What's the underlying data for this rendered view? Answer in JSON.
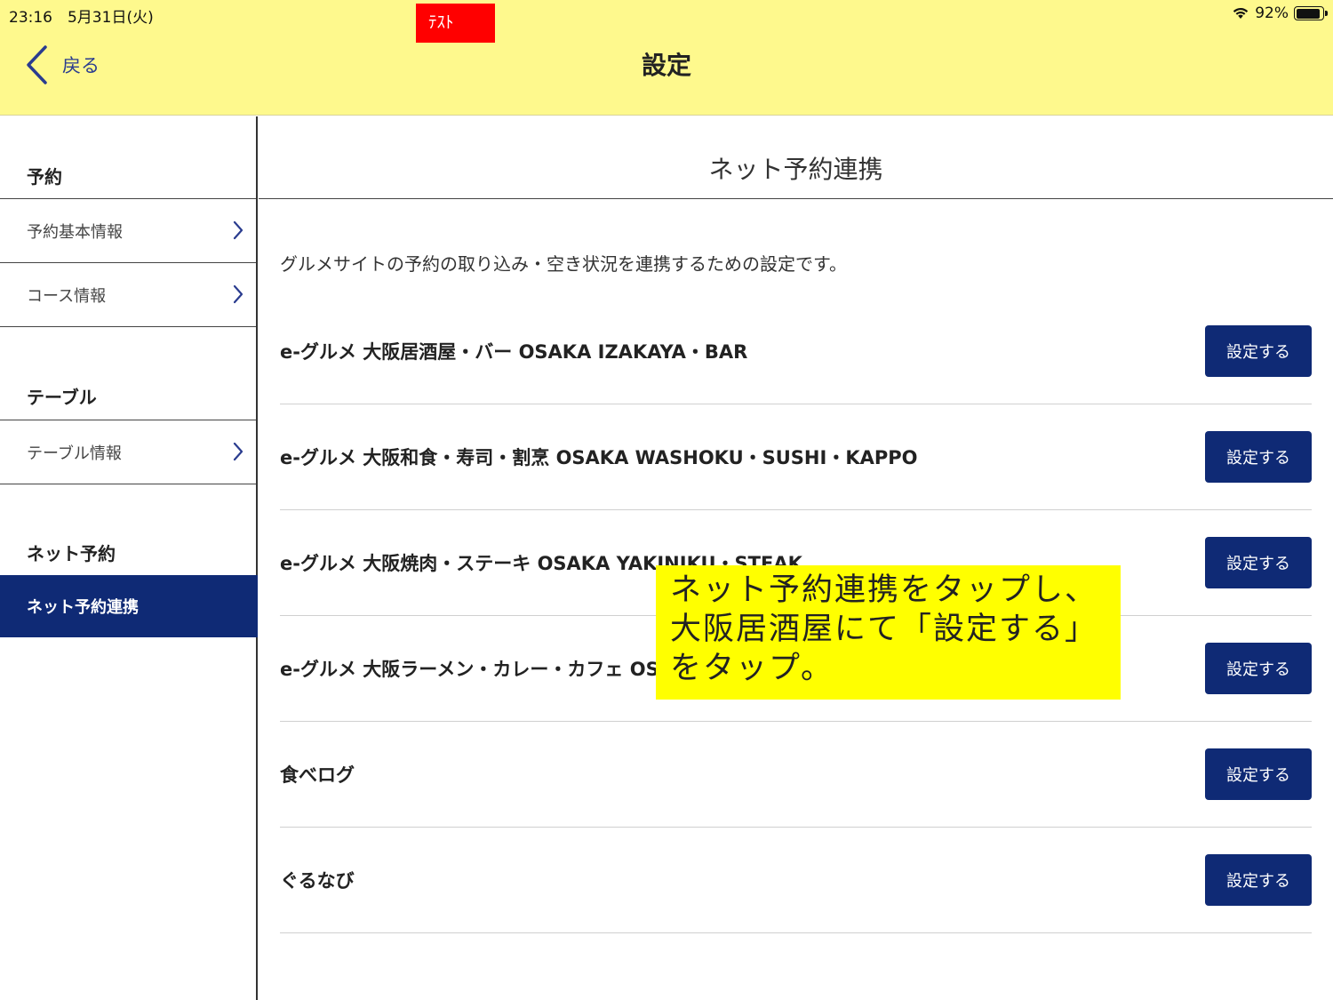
{
  "status_bar": {
    "time": "23:16　5月31日(火)",
    "battery": "92%",
    "battery_level": 0.92
  },
  "header": {
    "test_badge": "ﾃｽﾄ",
    "back_label": "戻る",
    "title": "設定"
  },
  "sidebar": {
    "sections": [
      {
        "title": "予約",
        "items": [
          "予約基本情報",
          "コース情報"
        ]
      },
      {
        "title": "テーブル",
        "items": [
          "テーブル情報"
        ]
      },
      {
        "title": "ネット予約",
        "items": [
          "ネット予約連携"
        ]
      }
    ]
  },
  "main": {
    "title": "ネット予約連携",
    "description": "グルメサイトの予約の取り込み・空き状況を連携するための設定です。",
    "button_label": "設定する",
    "rows": [
      "e-グルメ 大阪居酒屋・バー OSAKA IZAKAYA・BAR",
      "e-グルメ 大阪和食・寿司・割烹 OSAKA WASHOKU・SUSHI・KAPPO",
      "e-グルメ 大阪焼肉・ステーキ OSAKA YAKINIKU・STEAK",
      "e-グルメ 大阪ラーメン・カレー・カフェ OSAKA RAMEN・CURRY・CAFE",
      "食べログ",
      "ぐるなび"
    ]
  },
  "callout": {
    "lines": [
      "ネット予約連携をタップし、",
      "大阪居酒屋にて「設定する」",
      "をタップ。"
    ]
  },
  "colors": {
    "header_bg": "#fef98d",
    "accent": "#0f2a75",
    "test_badge": "#ff0000",
    "callout_bg": "#ffff00"
  }
}
